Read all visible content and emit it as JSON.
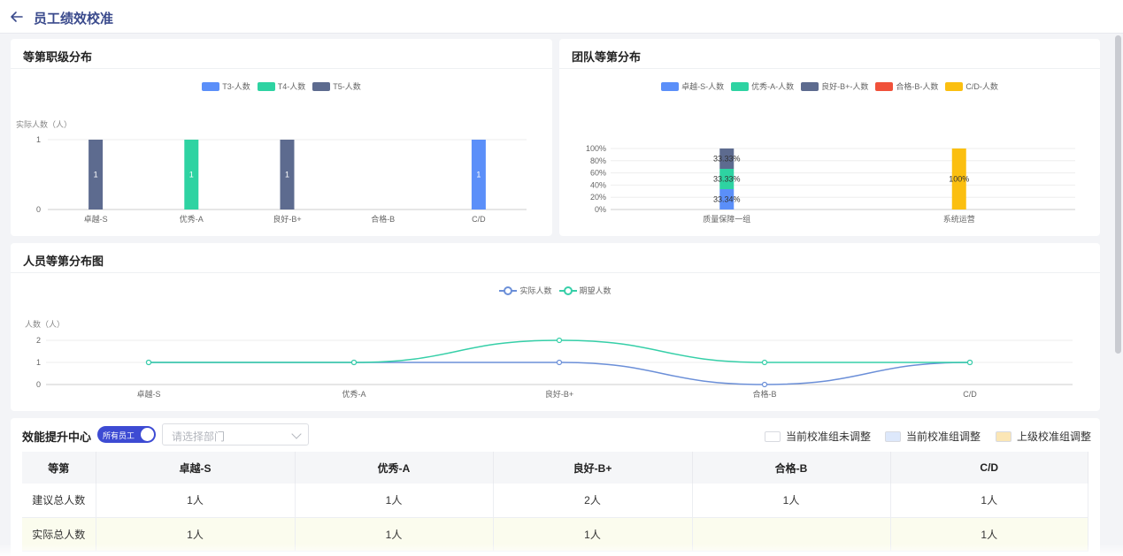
{
  "header": {
    "title": "员工绩效校准",
    "back_icon": "arrow-left-icon"
  },
  "grade_chart": {
    "title": "等第职级分布",
    "chart_data": {
      "type": "bar",
      "title": "",
      "ylabel": "实际人数（人）",
      "ylim": [
        0,
        1
      ],
      "yticks": [
        "0",
        "1"
      ],
      "categories": [
        "卓越-S",
        "优秀-A",
        "良好-B+",
        "合格-B",
        "C/D"
      ],
      "series": [
        {
          "name": "T3-人数",
          "color": "#5b8ff9",
          "values": [
            0,
            0,
            0,
            0,
            1
          ]
        },
        {
          "name": "T4-人数",
          "color": "#2ed3a2",
          "values": [
            0,
            1,
            0,
            0,
            0
          ]
        },
        {
          "name": "T5-人数",
          "color": "#5d6b8f",
          "values": [
            1,
            0,
            1,
            0,
            0
          ]
        }
      ],
      "legend": "top-center"
    }
  },
  "team_chart": {
    "title": "团队等第分布",
    "chart_data": {
      "type": "bar",
      "stacked": "percent",
      "title": "",
      "yticks": [
        "0%",
        "20%",
        "40%",
        "60%",
        "80%",
        "100%"
      ],
      "categories": [
        "质量保障一组",
        "系统运营"
      ],
      "series": [
        {
          "name": "卓越-S-人数",
          "color": "#5b8ff9",
          "values": [
            33.34,
            0
          ],
          "labels": [
            "33.34%",
            ""
          ]
        },
        {
          "name": "优秀-A-人数",
          "color": "#2ed3a2",
          "values": [
            33.33,
            0
          ],
          "labels": [
            "33.33%",
            ""
          ]
        },
        {
          "name": "良好-B+-人数",
          "color": "#5d6b8f",
          "values": [
            33.33,
            0
          ],
          "labels": [
            "33.33%",
            ""
          ]
        },
        {
          "name": "合格-B-人数",
          "color": "#f0513a",
          "values": [
            0,
            0
          ],
          "labels": [
            "",
            ""
          ]
        },
        {
          "name": "C/D-人数",
          "color": "#fbbf10",
          "values": [
            0,
            100
          ],
          "labels": [
            "",
            "100%"
          ]
        }
      ],
      "legend": "top-center"
    }
  },
  "people_chart": {
    "title": "人员等第分布图",
    "chart_data": {
      "type": "line",
      "title": "",
      "ylabel": "人数（人）",
      "ylim": [
        0,
        2
      ],
      "yticks": [
        "0",
        "1",
        "2"
      ],
      "categories": [
        "卓越-S",
        "优秀-A",
        "良好-B+",
        "合格-B",
        "C/D"
      ],
      "series": [
        {
          "name": "实际人数",
          "color": "#6b8fd8",
          "values": [
            1,
            1,
            1,
            0,
            1
          ]
        },
        {
          "name": "期望人数",
          "color": "#36cfa8",
          "values": [
            1,
            1,
            2,
            1,
            1
          ]
        }
      ],
      "legend": "top-center"
    }
  },
  "efficiency": {
    "title": "效能提升中心",
    "toggle_label": "所有员工",
    "dept_placeholder": "请选择部门",
    "legend": [
      {
        "label": "当前校准组未调整",
        "color": "#ffffff"
      },
      {
        "label": "当前校准组调整",
        "color": "#dde8fb"
      },
      {
        "label": "上级校准组调整",
        "color": "#fbe6b5"
      }
    ],
    "table": {
      "headers": [
        "等第",
        "卓越-S",
        "优秀-A",
        "良好-B+",
        "合格-B",
        "C/D"
      ],
      "rows": [
        [
          "建议总人数",
          "1人",
          "1人",
          "2人",
          "1人",
          "1人"
        ],
        [
          "实际总人数",
          "1人",
          "1人",
          "1人",
          "",
          "1人"
        ]
      ]
    }
  }
}
